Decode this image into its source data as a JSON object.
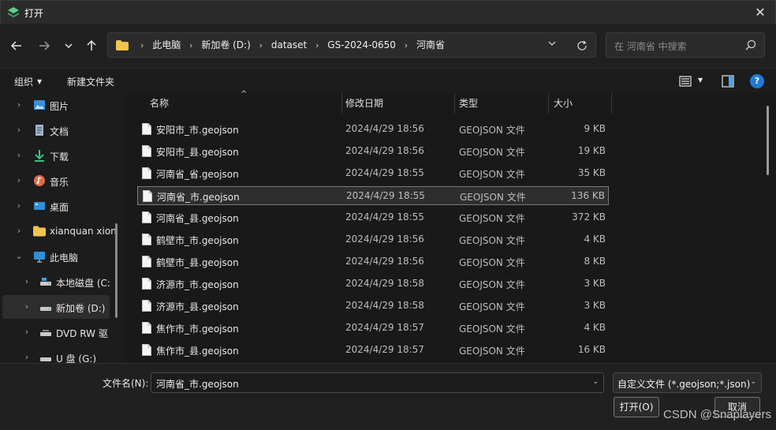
{
  "window": {
    "title": "打开",
    "close_glyph": "✕"
  },
  "nav": {
    "back_icon": "arrow-left-icon",
    "forward_icon": "arrow-right-icon",
    "recent_icon": "chevron-down-icon",
    "up_icon": "arrow-up-icon",
    "breadcrumbs": [
      "此电脑",
      "新加卷 (D:)",
      "dataset",
      "GS-2024-0650",
      "河南省"
    ],
    "search_placeholder": "在 河南省 中搜索"
  },
  "toolbar": {
    "organize_label": "组织",
    "new_folder_label": "新建文件夹"
  },
  "sidebar": {
    "items": [
      {
        "label": "图片",
        "icon": "pictures-icon"
      },
      {
        "label": "文档",
        "icon": "documents-icon"
      },
      {
        "label": "下载",
        "icon": "download-icon"
      },
      {
        "label": "音乐",
        "icon": "music-icon"
      },
      {
        "label": "桌面",
        "icon": "desktop-icon"
      },
      {
        "label": "xianquan xion",
        "icon": "folder-icon"
      },
      {
        "label": "此电脑",
        "icon": "computer-icon"
      },
      {
        "label": "本地磁盘 (C:",
        "icon": "drive-icon"
      },
      {
        "label": "新加卷 (D:)",
        "icon": "drive-icon"
      },
      {
        "label": "DVD RW 驱",
        "icon": "dvd-icon"
      },
      {
        "label": "U 盘 (G:)",
        "icon": "usb-drive-icon"
      }
    ],
    "selected": "新加卷 (D:)"
  },
  "columns": {
    "name": "名称",
    "date": "修改日期",
    "type": "类型",
    "size": "大小"
  },
  "files": [
    {
      "name": "安阳市_市.geojson",
      "date": "2024/4/29 18:56",
      "type": "GEOJSON 文件",
      "size": "9 KB"
    },
    {
      "name": "安阳市_县.geojson",
      "date": "2024/4/29 18:56",
      "type": "GEOJSON 文件",
      "size": "19 KB"
    },
    {
      "name": "河南省_省.geojson",
      "date": "2024/4/29 18:55",
      "type": "GEOJSON 文件",
      "size": "35 KB"
    },
    {
      "name": "河南省_市.geojson",
      "date": "2024/4/29 18:55",
      "type": "GEOJSON 文件",
      "size": "136 KB"
    },
    {
      "name": "河南省_县.geojson",
      "date": "2024/4/29 18:55",
      "type": "GEOJSON 文件",
      "size": "372 KB"
    },
    {
      "name": "鹤壁市_市.geojson",
      "date": "2024/4/29 18:56",
      "type": "GEOJSON 文件",
      "size": "4 KB"
    },
    {
      "name": "鹤壁市_县.geojson",
      "date": "2024/4/29 18:56",
      "type": "GEOJSON 文件",
      "size": "8 KB"
    },
    {
      "name": "济源市_市.geojson",
      "date": "2024/4/29 18:58",
      "type": "GEOJSON 文件",
      "size": "3 KB"
    },
    {
      "name": "济源市_县.geojson",
      "date": "2024/4/29 18:58",
      "type": "GEOJSON 文件",
      "size": "3 KB"
    },
    {
      "name": "焦作市_市.geojson",
      "date": "2024/4/29 18:57",
      "type": "GEOJSON 文件",
      "size": "4 KB"
    },
    {
      "name": "焦作市_县.geojson",
      "date": "2024/4/29 18:57",
      "type": "GEOJSON 文件",
      "size": "16 KB"
    }
  ],
  "selected_file": "河南省_市.geojson",
  "footer": {
    "filename_label": "文件名(N):",
    "filename_value": "河南省_市.geojson",
    "filter_value": "自定义文件 (*.geojson;*.json)",
    "open_label": "打开(O)",
    "cancel_label": "取消",
    "watermark": "CSDN @Snaplayers"
  },
  "colors": {
    "accent": "#1f7ad6",
    "background": "#202020",
    "list_background": "#191919"
  }
}
